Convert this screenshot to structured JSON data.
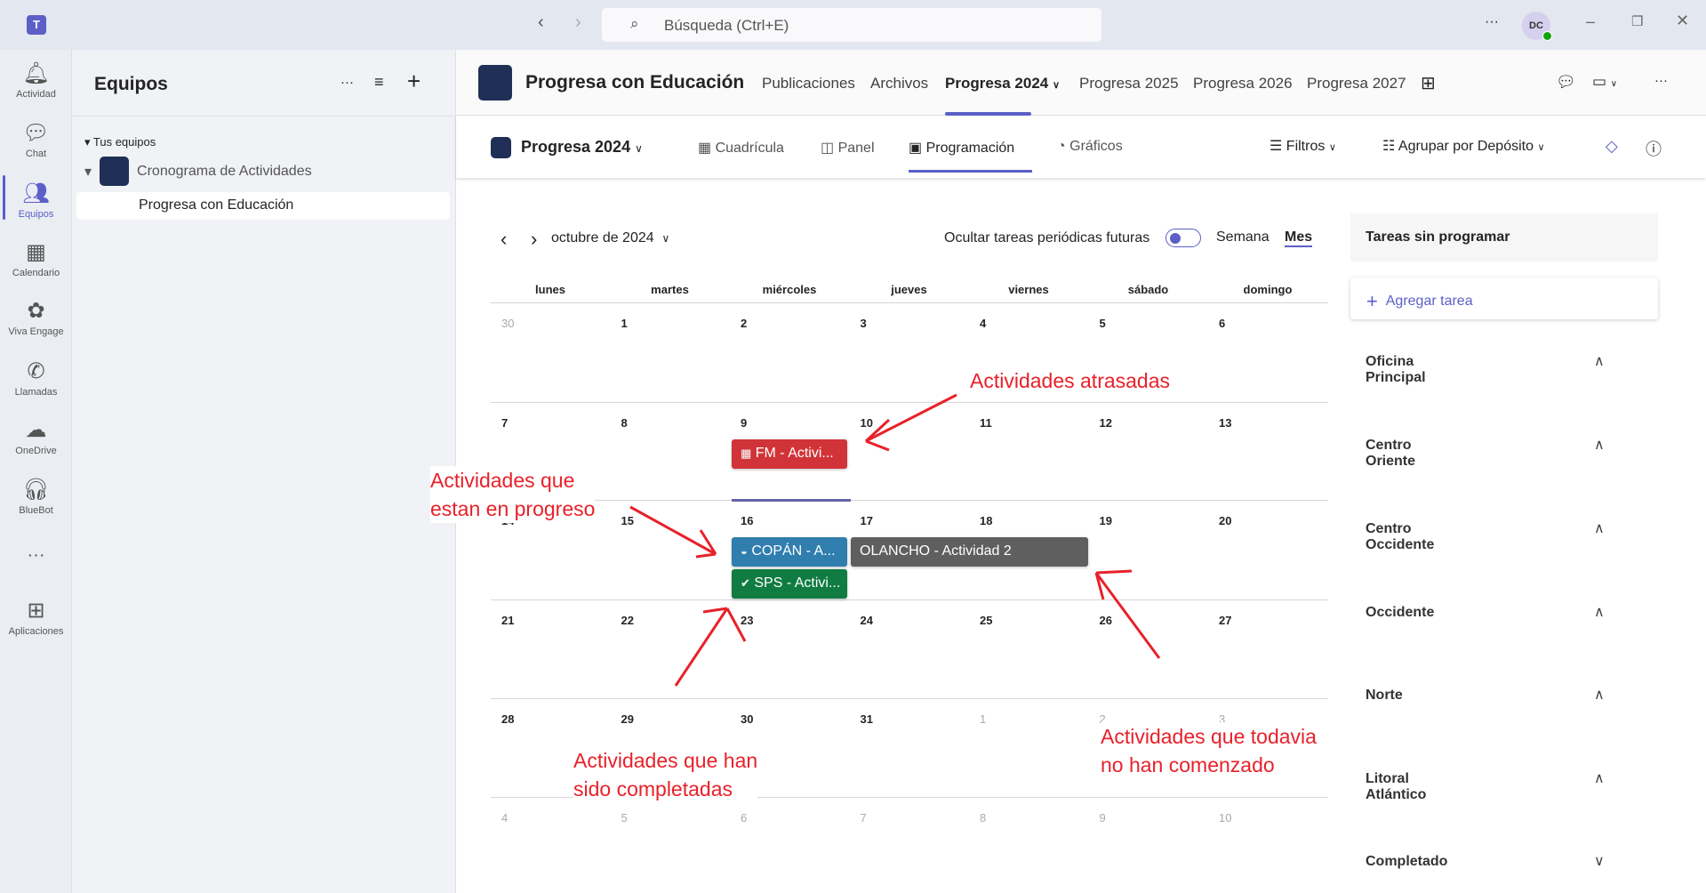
{
  "topbar": {
    "search_placeholder": "Búsqueda (Ctrl+E)",
    "avatar": "DC"
  },
  "rail": [
    {
      "label": "Actividad",
      "icon": "bell-icon"
    },
    {
      "label": "Chat",
      "icon": "chat-icon"
    },
    {
      "label": "Equipos",
      "icon": "teams-icon",
      "active": true
    },
    {
      "label": "Calendario",
      "icon": "calendar-icon"
    },
    {
      "label": "Viva Engage",
      "icon": "viva-icon"
    },
    {
      "label": "Llamadas",
      "icon": "phone-icon"
    },
    {
      "label": "OneDrive",
      "icon": "cloud-icon"
    },
    {
      "label": "BlueBot",
      "icon": "bot-icon"
    },
    {
      "label": "Aplicaciones",
      "icon": "plus-box-icon"
    }
  ],
  "teams": {
    "title": "Equipos",
    "section": "Tus equipos",
    "team": "Cronograma de Actividades",
    "channel": "Progresa con Educación"
  },
  "header": {
    "title": "Progresa con Educación",
    "tabs": [
      "Publicaciones",
      "Archivos",
      "Progresa 2024",
      "Progresa 2025",
      "Progresa 2026",
      "Progresa 2027"
    ],
    "active_tab": "Progresa 2024"
  },
  "planner": {
    "plan": "Progresa 2024",
    "views": [
      "Cuadrícula",
      "Panel",
      "Programación",
      "Gráficos"
    ],
    "active_view": "Programación",
    "filters": "Filtros",
    "group": "Agrupar por Depósito"
  },
  "calendar": {
    "month": "octubre de 2024",
    "hide_label": "Ocultar tareas periódicas futuras",
    "week": "Semana",
    "month_btn": "Mes",
    "weekdays": [
      "lunes",
      "martes",
      "miércoles",
      "jueves",
      "viernes",
      "sábado",
      "domingo"
    ],
    "weeks": [
      [
        "30",
        "1",
        "2",
        "3",
        "4",
        "5",
        "6"
      ],
      [
        "7",
        "8",
        "9",
        "10",
        "11",
        "12",
        "13"
      ],
      [
        "14",
        "15",
        "16",
        "17",
        "18",
        "19",
        "20"
      ],
      [
        "21",
        "22",
        "23",
        "24",
        "25",
        "26",
        "27"
      ],
      [
        "28",
        "29",
        "30",
        "31",
        "1",
        "2",
        "3"
      ],
      [
        "4",
        "5",
        "6",
        "7",
        "8",
        "9",
        "10"
      ]
    ],
    "events": [
      {
        "label": "FM - Activi...",
        "status": "late",
        "color": "#d13438"
      },
      {
        "label": "COPÁN - A...",
        "status": "in-progress",
        "color": "#2f7eae"
      },
      {
        "label": "SPS - Activi...",
        "status": "completed",
        "color": "#107c41"
      },
      {
        "label": "OLANCHO - Actividad 2",
        "status": "not-started",
        "color": "#5f5f5f"
      }
    ]
  },
  "unscheduled": {
    "title": "Tareas sin programar",
    "add": "Agregar tarea",
    "groups": [
      "Oficina Principal",
      "Centro Oriente",
      "Centro Occidente",
      "Occidente",
      "Norte",
      "Litoral Atlántico",
      "Completado"
    ]
  },
  "annotations": [
    "Actividades atrasadas",
    "Actividades que\nestan en progreso",
    "Actividades que han\nsido completadas",
    "Actividades que todavia\nno han comenzado"
  ]
}
